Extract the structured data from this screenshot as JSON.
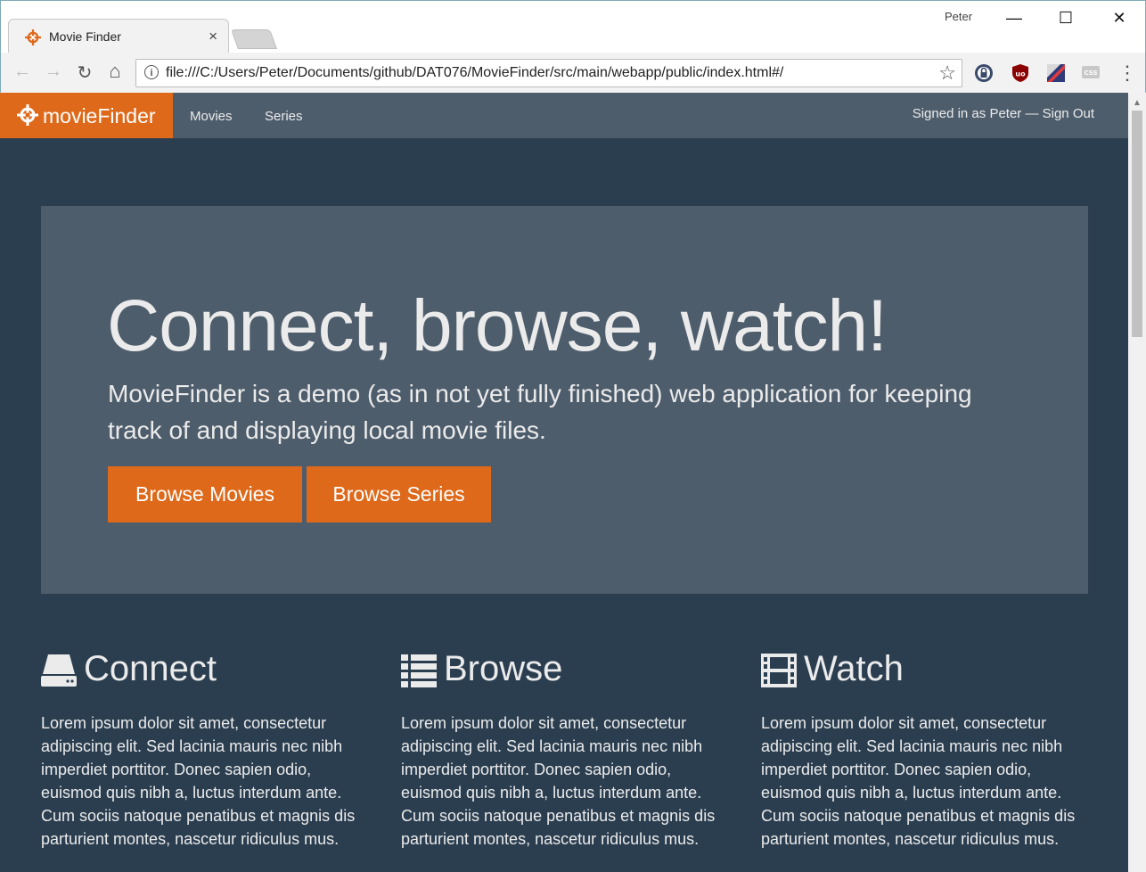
{
  "browser": {
    "tab_title": "Movie Finder",
    "tab_close": "×",
    "profile_name": "Peter",
    "url": "file:///C:/Users/Peter/Documents/github/DAT076/MovieFinder/src/main/webapp/public/index.html#/",
    "window_minimize": "—",
    "window_maximize": "☐",
    "window_close": "✕",
    "back": "←",
    "forward": "→",
    "reload": "↻",
    "home": "⌂",
    "star": "☆",
    "menu": "⋮"
  },
  "navbar": {
    "brand": "movieFinder",
    "links": [
      "Movies",
      "Series"
    ],
    "user_status": "Signed in as Peter — Sign Out"
  },
  "hero": {
    "title": "Connect, browse, watch!",
    "lead": "MovieFinder is a demo (as in not yet fully finished) web application for keeping track of and displaying local movie files.",
    "buttons": [
      "Browse Movies",
      "Browse Series"
    ]
  },
  "features": [
    {
      "title": "Connect",
      "icon": "hdd-icon",
      "text": "Lorem ipsum dolor sit amet, consectetur adipiscing elit. Sed lacinia mauris nec nibh imperdiet porttitor. Donec sapien odio, euismod quis nibh a, luctus interdum ante. Cum sociis natoque penatibus et magnis dis parturient montes, nascetur ridiculus mus."
    },
    {
      "title": "Browse",
      "icon": "list-icon",
      "text": "Lorem ipsum dolor sit amet, consectetur adipiscing elit. Sed lacinia mauris nec nibh imperdiet porttitor. Donec sapien odio, euismod quis nibh a, luctus interdum ante. Cum sociis natoque penatibus et magnis dis parturient montes, nascetur ridiculus mus."
    },
    {
      "title": "Watch",
      "icon": "film-icon",
      "text": "Lorem ipsum dolor sit amet, consectetur adipiscing elit. Sed lacinia mauris nec nibh imperdiet porttitor. Donec sapien odio, euismod quis nibh a, luctus interdum ante. Cum sociis natoque penatibus et magnis dis parturient montes, nascetur ridiculus mus."
    }
  ],
  "colors": {
    "brand_orange": "#df691a",
    "navbar_bg": "#4e5d6c",
    "page_bg": "#2b3e50",
    "text_light": "#ebebeb"
  }
}
